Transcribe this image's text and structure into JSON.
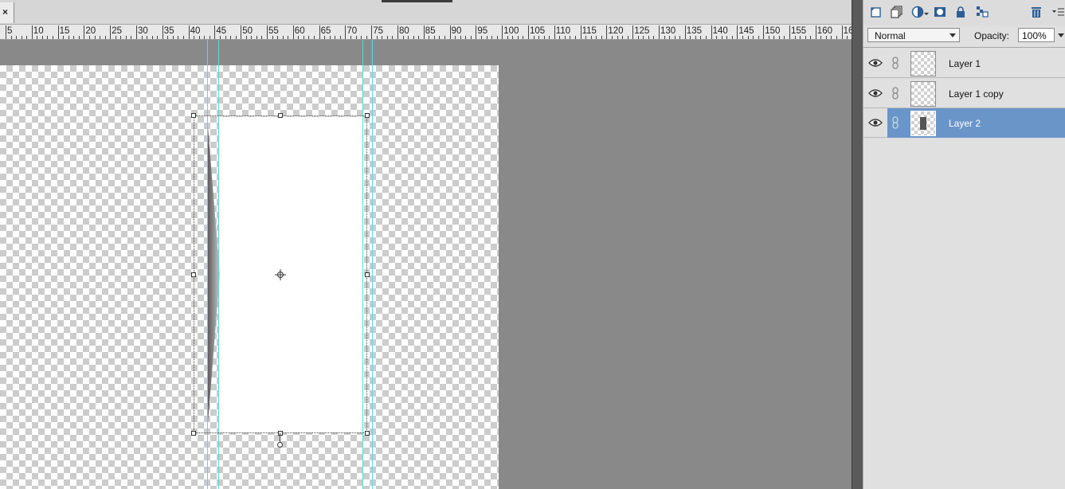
{
  "tab": {
    "close_glyph": "×"
  },
  "ruler": {
    "labels": [
      "5",
      "10",
      "15",
      "20",
      "25",
      "30",
      "35",
      "40",
      "45",
      "50",
      "55",
      "60",
      "65",
      "70",
      "75",
      "80",
      "85",
      "90",
      "95",
      "100",
      "105",
      "110",
      "115",
      "120",
      "125",
      "130",
      "135",
      "140",
      "145",
      "150",
      "155",
      "160",
      "16"
    ]
  },
  "toolbar_icons": [
    "new-layer-icon",
    "new-group-icon",
    "adjustment-layer-icon",
    "layer-mask-icon",
    "lock-icon",
    "lock-transparency-icon",
    "trash-icon",
    "panel-menu-icon"
  ],
  "layers_panel": {
    "blend_mode": "Normal",
    "opacity_label": "Opacity:",
    "opacity_value": "100%",
    "layers": [
      {
        "name": "Layer 1",
        "selected": false
      },
      {
        "name": "Layer 1 copy",
        "selected": false
      },
      {
        "name": "Layer 2",
        "selected": true
      }
    ]
  },
  "colors": {
    "selection": "#6a95c8",
    "guide": "#5fd7d7",
    "canvas_bg": "#898989"
  }
}
